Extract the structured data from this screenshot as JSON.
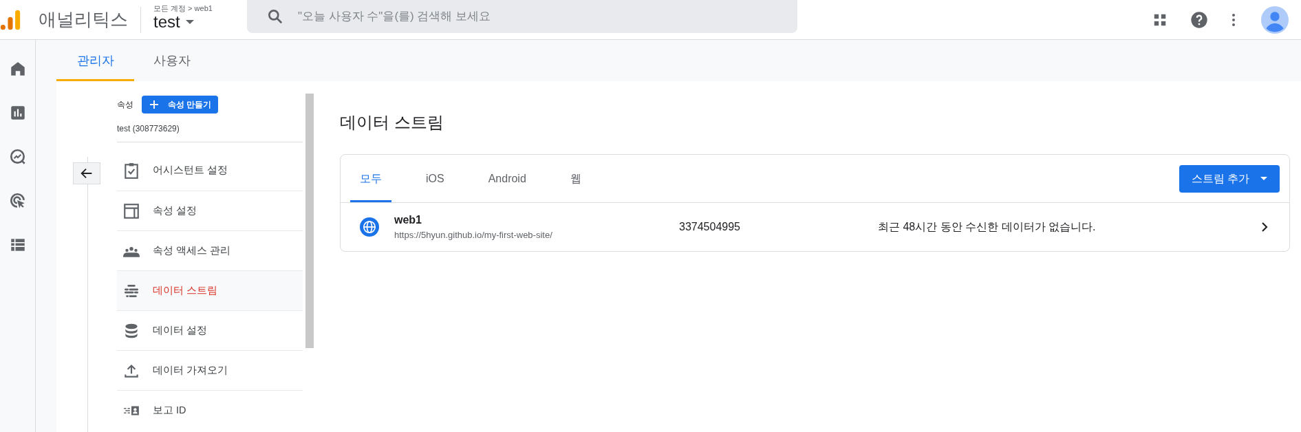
{
  "header": {
    "title": "애널리틱스",
    "breadcrumb": "모든 계정 > web1",
    "property": "test",
    "search": {
      "placeholder": "\"오늘 사용자 수\"을(를) 검색해 보세요"
    }
  },
  "rail": [
    {
      "kind": "home",
      "selected": false
    },
    {
      "kind": "reports",
      "selected": false
    },
    {
      "kind": "explore",
      "selected": false
    },
    {
      "kind": "advertising",
      "selected": false
    },
    {
      "kind": "list",
      "selected": false
    }
  ],
  "admin_tabs": [
    {
      "label": "관리자",
      "selected": true
    },
    {
      "label": "사용자",
      "selected": false
    }
  ],
  "sidebar": {
    "section_label": "속성",
    "create_button": "속성 만들기",
    "property_name": "test (308773629)",
    "items": [
      {
        "kind": "assistant",
        "label": "어시스턴트 설정",
        "selected": false
      },
      {
        "kind": "settings",
        "label": "속성 설정",
        "selected": false
      },
      {
        "kind": "access",
        "label": "속성 액세스 관리",
        "selected": false
      },
      {
        "kind": "streams",
        "label": "데이터 스트림",
        "selected": true
      },
      {
        "kind": "data",
        "label": "데이터 설정",
        "selected": false
      },
      {
        "kind": "import",
        "label": "데이터 가져오기",
        "selected": false
      },
      {
        "kind": "report_id",
        "label": "보고 ID",
        "selected": false
      }
    ]
  },
  "main": {
    "title": "데이터 스트림",
    "tabs": [
      {
        "label": "모두",
        "selected": true
      },
      {
        "label": "iOS",
        "selected": false
      },
      {
        "label": "Android",
        "selected": false
      },
      {
        "label": "웹",
        "selected": false
      }
    ],
    "add_button": "스트림 추가",
    "streams": [
      {
        "name": "web1",
        "url": "https://5hyun.github.io/my-first-web-site/",
        "id": "3374504995",
        "status": "최근 48시간 동안 수신한 데이터가 없습니다."
      }
    ]
  }
}
